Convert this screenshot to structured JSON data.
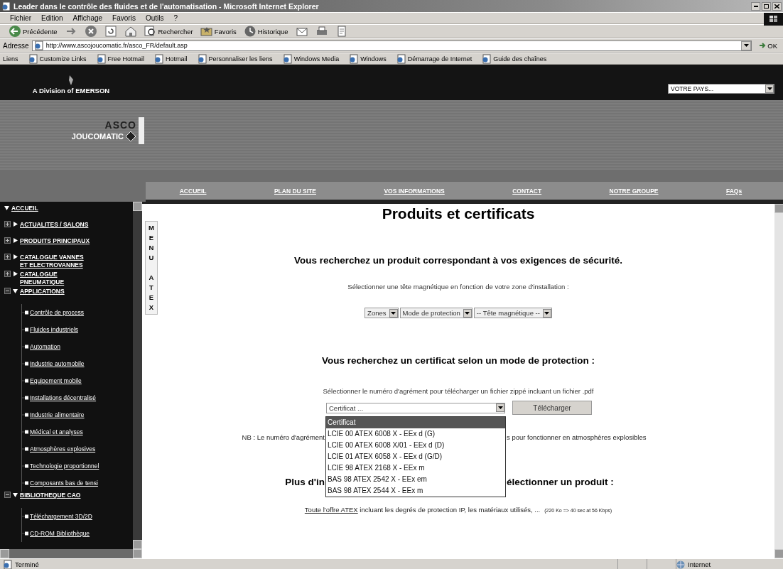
{
  "window": {
    "title": "Leader dans le contrôle des fluides et de l'automatisation - Microsoft Internet Explorer"
  },
  "menu_bar": [
    "Fichier",
    "Edition",
    "Affichage",
    "Favoris",
    "Outils",
    "?"
  ],
  "toolbar": [
    {
      "kind": "back",
      "label": "Précédente"
    },
    {
      "kind": "forward"
    },
    {
      "kind": "stop"
    },
    {
      "kind": "refresh"
    },
    {
      "kind": "home"
    },
    {
      "kind": "search",
      "label": "Rechercher"
    },
    {
      "kind": "favorites",
      "label": "Favoris"
    },
    {
      "kind": "history",
      "label": "Historique"
    },
    {
      "kind": "mail"
    },
    {
      "kind": "print"
    },
    {
      "kind": "edit"
    }
  ],
  "address_bar": {
    "label": "Adresse",
    "url": "http://www.ascojoucomatic.fr/asco_FR/default.asp",
    "go": "OK"
  },
  "links_bar": {
    "label": "Liens",
    "links": [
      "Customize Links",
      "Free Hotmail",
      "Hotmail",
      "Personnaliser les liens",
      "Windows Media",
      "Windows",
      "Démarrage de Internet",
      "Guide des chaînes"
    ]
  },
  "site_header": {
    "division": "A Division of EMERSON",
    "country_select": "VOTRE PAYS...",
    "logo_top": "ASCO",
    "logo_bottom": "JOUCOMATIC"
  },
  "nav": [
    "ACCUEIL",
    "PLAN DU SITE",
    "VOS INFORMATIONS",
    "CONTACT",
    "NOTRE GROUPE",
    "FAQs"
  ],
  "sidebar": {
    "items": [
      {
        "label": "ACCUEIL",
        "kind": "root",
        "expanded": true
      },
      {
        "label": "ACTUALITES / SALONS",
        "kind": "branch",
        "expanded": false
      },
      {
        "label": "PRODUITS PRINCIPAUX",
        "kind": "branch",
        "expanded": false
      },
      {
        "label": "CATALOGUE VANNES ET ELECTROVANNES",
        "kind": "branch",
        "expanded": false
      },
      {
        "label": "CATALOGUE PNEUMATIQUE",
        "kind": "branch",
        "expanded": false
      },
      {
        "label": "APPLICATIONS",
        "kind": "branch",
        "expanded": true,
        "children": [
          {
            "label": "Contrôle de process"
          },
          {
            "label": "Fluides industriels"
          },
          {
            "label": "Automation"
          },
          {
            "label": "Industrie automobile"
          },
          {
            "label": "Equipement mobile"
          },
          {
            "label": "Installations décentralisé"
          },
          {
            "label": "Industrie alimentaire"
          },
          {
            "label": "Médical et analyses"
          },
          {
            "label": "Atmosphères explosives"
          },
          {
            "label": "Technologie proportionnel"
          },
          {
            "label": "Composants bas de tensi"
          }
        ]
      },
      {
        "label": "BIBLIOTHEQUE CAO",
        "kind": "branch",
        "expanded": true,
        "children": [
          {
            "label": "Téléchargement 3D/2D"
          },
          {
            "label": "CD-ROM Bibliothèque"
          }
        ]
      }
    ]
  },
  "side_tab": [
    "MENU",
    "ATEX"
  ],
  "content": {
    "title": "Produits et certificats",
    "product_heading": "Vous recherchez un produit correspondant à vos exigences de sécurité.",
    "product_hint": "Sélectionner une tête magnétique en fonction de votre zone d'installation :",
    "product_selects": [
      "Zones",
      "Mode de protection",
      "-- Tête magnétique --"
    ],
    "certificate_heading": "Vous recherchez un certificat selon un mode de protection :",
    "certificate_hint": "Sélectionner le numéro d'agrément pour télécharger un fichier zippé incluant un fichier .pdf",
    "certificate_select": "Certificat ...",
    "download_button": "Télécharger",
    "certificate_options": [
      {
        "label": "Certificat",
        "selected": true
      },
      {
        "label": "LCIE 00 ATEX 6008 X - EEx d (G)",
        "selected": false
      },
      {
        "label": "LCIE 00 ATEX 6008 X/01 - EEx d (D)",
        "selected": false
      },
      {
        "label": "LCIE 01 ATEX 6058 X - EEx d (G/D)",
        "selected": false
      },
      {
        "label": "LCIE 98 ATEX 2168 X - EEx m",
        "selected": false
      },
      {
        "label": "BAS 98 ATEX 2542 X - EEx em",
        "selected": false
      },
      {
        "label": "BAS 98 ATEX 2544 X - EEx m",
        "selected": false
      }
    ],
    "nb_left": "NB : Le numéro d'agrément",
    "nb_right": "s pour fonctionner en atmosphères explosibles",
    "more_left": "Plus d'in",
    "more_right": "électionner un produit :",
    "offer_link": "Toute l'offre ATEX",
    "offer_text": " incluant les degrés de protection IP, les matériaux utilisés, ...",
    "offer_note": "(220 Ko => 40 sec at 56 Kbps)"
  },
  "status_bar": {
    "text": "Terminé",
    "zone": "Internet"
  }
}
